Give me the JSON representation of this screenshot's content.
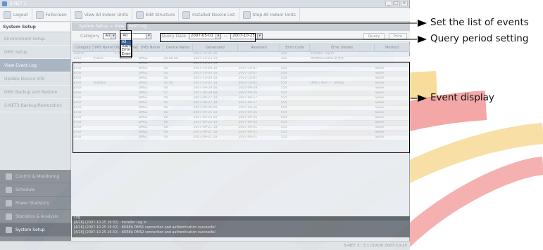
{
  "window": {
    "title": "S-NET 3"
  },
  "toolbar": [
    {
      "label": "Logout",
      "icon": "logout-icon"
    },
    {
      "label": "Fullscreen",
      "icon": "fullscreen-icon"
    },
    {
      "label": "View All Indoor Units",
      "icon": "view-all-icon"
    },
    {
      "label": "Edit Structure",
      "icon": "edit-structure-icon"
    },
    {
      "label": "Installed Device List",
      "icon": "device-list-icon"
    },
    {
      "label": "Stop All Indoor Units",
      "icon": "stop-all-icon"
    }
  ],
  "sidebar": {
    "header": "System Setup",
    "items": [
      {
        "label": "Environment Setup"
      },
      {
        "label": "DMS Setup"
      },
      {
        "label": "View Event Log"
      },
      {
        "label": "Update Device Info"
      },
      {
        "label": "DMS Backup and Restore"
      },
      {
        "label": "S-NET3 Backup/Restoration"
      }
    ],
    "active_item": "View Event Log",
    "nav": [
      {
        "label": "Control & Monitoring"
      },
      {
        "label": "Schedule"
      },
      {
        "label": "Power Statistics"
      },
      {
        "label": "Statistics & Analysis"
      },
      {
        "label": "System Setup"
      }
    ],
    "active_nav": "System Setup"
  },
  "main": {
    "breadcrumb": "System Setup > View Event Log",
    "filter": {
      "category_label": "Category",
      "category_value": "All",
      "category_options": [
        "All",
        "Alarm",
        "Error",
        "Event"
      ],
      "second_value": "All",
      "query_label": "Query Date",
      "date_from": "2007-05-01",
      "date_sep": "~",
      "date_to": "2007-10-25",
      "query_button": "Query",
      "print_button": "Print"
    },
    "columns": [
      "Category",
      "DMS Name",
      "Object Name",
      "DMS Name",
      "Device Name",
      "Generated",
      "Resolved",
      "Error Code",
      "Error Details",
      "Method"
    ],
    "rows": [
      [
        "Inform",
        "",
        "S-NET 3",
        "",
        "",
        "2007-10-25 10",
        "",
        "100",
        "Installer Log In",
        ""
      ],
      [
        "Error",
        "Indoor",
        "",
        "DMS2",
        "06.06.00",
        "2007-10-23 19",
        "",
        "165",
        "MISMATCHING of the",
        ""
      ],
      [
        "Error",
        "",
        "",
        "DMS2",
        "",
        "2007-10-23 19",
        "",
        "",
        "",
        ""
      ],
      [
        "Error",
        "",
        "",
        "DMS1",
        "06",
        "2007-10-09 18",
        "2007-10-07",
        "554",
        "",
        "Solve"
      ],
      [
        "Error",
        "",
        "",
        "DMS1",
        "06",
        "2007-10-09 18",
        "2007-10-07",
        "554",
        "",
        "Solve"
      ],
      [
        "Error",
        "",
        "",
        "DMS1",
        "06",
        "2007-10-09 18",
        "2007-10-01",
        "554",
        "",
        "Solve"
      ],
      [
        "Error",
        "Outdoor",
        "",
        "DMS1",
        "06.00",
        "2007-10-02 18",
        "2007-10-01",
        "554",
        "DMS CAGP --- TRANS",
        "Solve"
      ],
      [
        "Error",
        "",
        "",
        "DMS1",
        "06",
        "2007-09-29 08",
        "2007-09-29",
        "554",
        "",
        "Solve"
      ],
      [
        "Error",
        "",
        "",
        "DMS1",
        "07",
        "2007-09-29 08",
        "2007-09-29",
        "554",
        "",
        "Solve"
      ],
      [
        "Error",
        "",
        "",
        "DMS1",
        "06",
        "2007-09-27 18",
        "2007-09-27",
        "554",
        "",
        "Solve"
      ],
      [
        "Error",
        "",
        "",
        "DMS1",
        "06",
        "2007-09-27 18",
        "2007-09-27",
        "554",
        "",
        "Solve"
      ],
      [
        "Error",
        "",
        "",
        "DMS1",
        "06",
        "2007-09-26 09",
        "2007-09-26",
        "554",
        "",
        "Solve"
      ],
      [
        "Error",
        "",
        "",
        "DMS1",
        "06",
        "2007-09-25 18",
        "2007-09-25",
        "554",
        "",
        "Solve"
      ],
      [
        "Error",
        "",
        "",
        "DMS1",
        "06",
        "2007-09-25 09",
        "2007-09-25",
        "554",
        "",
        "Solve"
      ],
      [
        "Error",
        "",
        "",
        "DMS1",
        "06",
        "2007-09-25 09",
        "2007-09-25",
        "554",
        "",
        "Solve"
      ],
      [
        "Error",
        "",
        "",
        "DMS1",
        "06",
        "2007-09-21 18",
        "2007-09-21",
        "554",
        "",
        "Solve"
      ],
      [
        "Error",
        "",
        "",
        "DMS1",
        "06",
        "2007-09-21 18",
        "2007-09-21",
        "554",
        "",
        "Solve"
      ],
      [
        "Error",
        "",
        "",
        "DMS1",
        "06",
        "2007-09-21 18",
        "2007-09-21",
        "554",
        "",
        "Solve"
      ]
    ]
  },
  "log": {
    "header": "Log",
    "lines": [
      "[4/26] (2007-10-25 16:32) : Installer Log in",
      "[4/26] (2007-10-25 16:32) : KOREA DMS1 connection and authentication successful",
      "[4/26] (2007-10-25 16:32) : KOREA DMS2 connection and authentication successful"
    ]
  },
  "status": {
    "text": "S-NET 3 : 3.1 (3019)   2007-10-25"
  },
  "annotations": {
    "list": "Set the list of events",
    "period": "Query period setting",
    "display": "Event display"
  },
  "colors": {
    "annotation_line": "#000000",
    "watermark_red": "#e8504f",
    "watermark_blue": "#3fa6e8",
    "watermark_yellow": "#f2bf4b"
  }
}
